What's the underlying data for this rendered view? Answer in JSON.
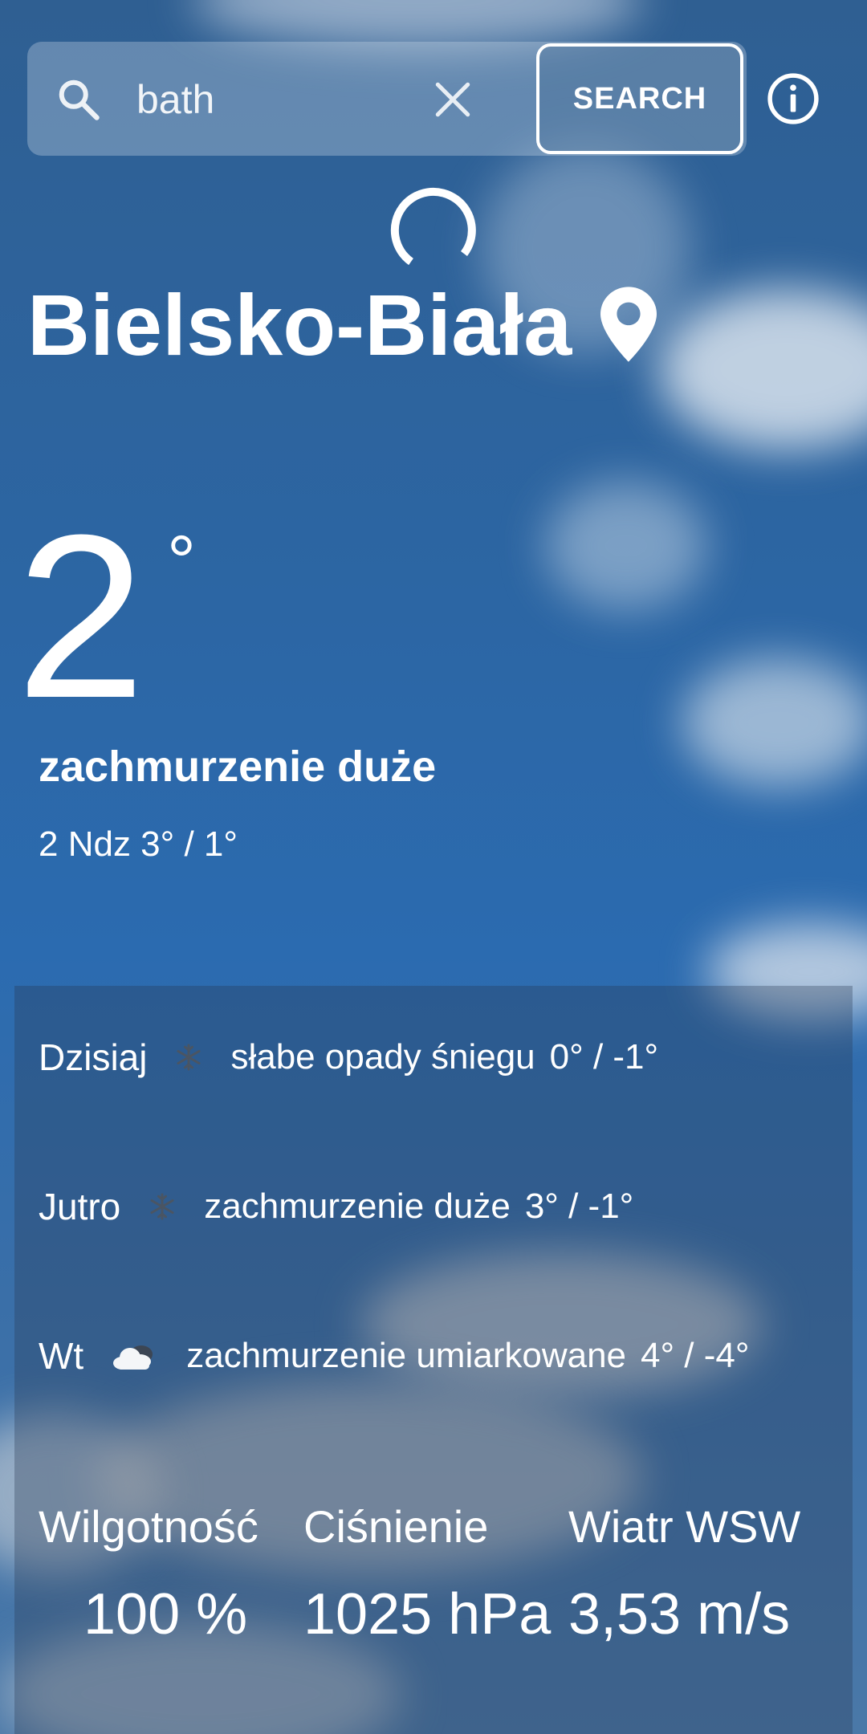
{
  "search": {
    "value": "bath",
    "button_label": "SEARCH"
  },
  "icons": {
    "search": "search-icon",
    "clear": "close-icon",
    "info": "info-icon",
    "loading": "loading-spinner",
    "location": "map-pin-icon"
  },
  "location": {
    "city": "Bielsko-Biała"
  },
  "current": {
    "temperature": "2",
    "degree": "°",
    "condition": "zachmurzenie duże",
    "date_range": "2 Ndz 3° / 1°"
  },
  "forecast": [
    {
      "day": "Dzisiaj",
      "icon": "snowflake-icon",
      "description": "słabe opady śniegu",
      "range": "0° / -1°"
    },
    {
      "day": "Jutro",
      "icon": "snowflake-icon",
      "description": "zachmurzenie duże",
      "range": "3° / -1°"
    },
    {
      "day": "Wt",
      "icon": "cloud-icon",
      "description": "zachmurzenie umiarkowane",
      "range": "4° / -4°"
    }
  ],
  "stats": {
    "humidity": {
      "label": "Wilgotność",
      "value": "100 %"
    },
    "pressure": {
      "label": "Ciśnienie",
      "value": "1025 hPa"
    },
    "wind": {
      "label": "Wiatr WSW",
      "value": "3,53 m/s"
    }
  },
  "colors": {
    "sky": "#2c66a4",
    "text": "#ffffff"
  }
}
